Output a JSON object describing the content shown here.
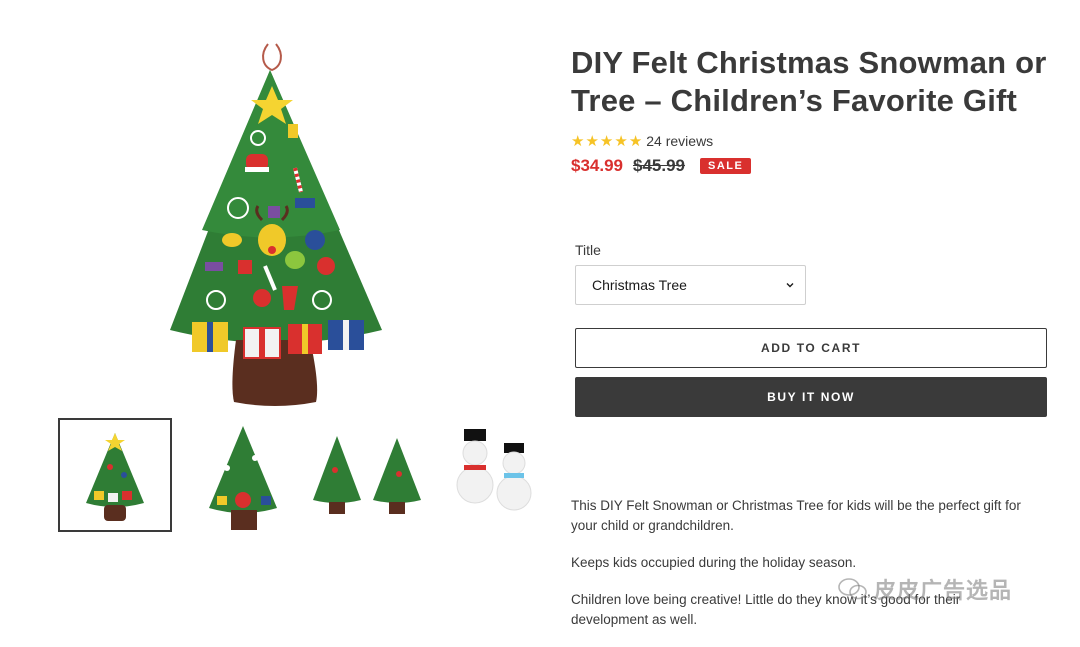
{
  "product": {
    "title": "DIY Felt Christmas Snowman or Tree – Children’s Favorite Gift",
    "rating": 5,
    "reviews_label": "24 reviews",
    "price": "$34.99",
    "compare_price": "$45.99",
    "sale_badge": "SALE"
  },
  "variant": {
    "label": "Title",
    "selected": "Christmas Tree"
  },
  "buttons": {
    "add_to_cart": "ADD TO CART",
    "buy_now": "BUY IT NOW"
  },
  "description": {
    "paragraphs": [
      "This DIY Felt Snowman or Christmas Tree for kids will be the perfect gift for your child or grandchildren.",
      "Keeps kids occupied during the holiday season.",
      "Children love being creative! Little do they know it’s good for their development as well."
    ]
  },
  "colors": {
    "sale_red": "#d9302e",
    "star_yellow": "#f6c326",
    "dark_button": "#3a3a3a",
    "tree_green": "#2f7d35",
    "trunk_brown": "#5a2e1f"
  },
  "watermark": "皮皮广告选品",
  "icons": [
    "star-icon",
    "chevron-down-icon",
    "wechat-icon"
  ]
}
